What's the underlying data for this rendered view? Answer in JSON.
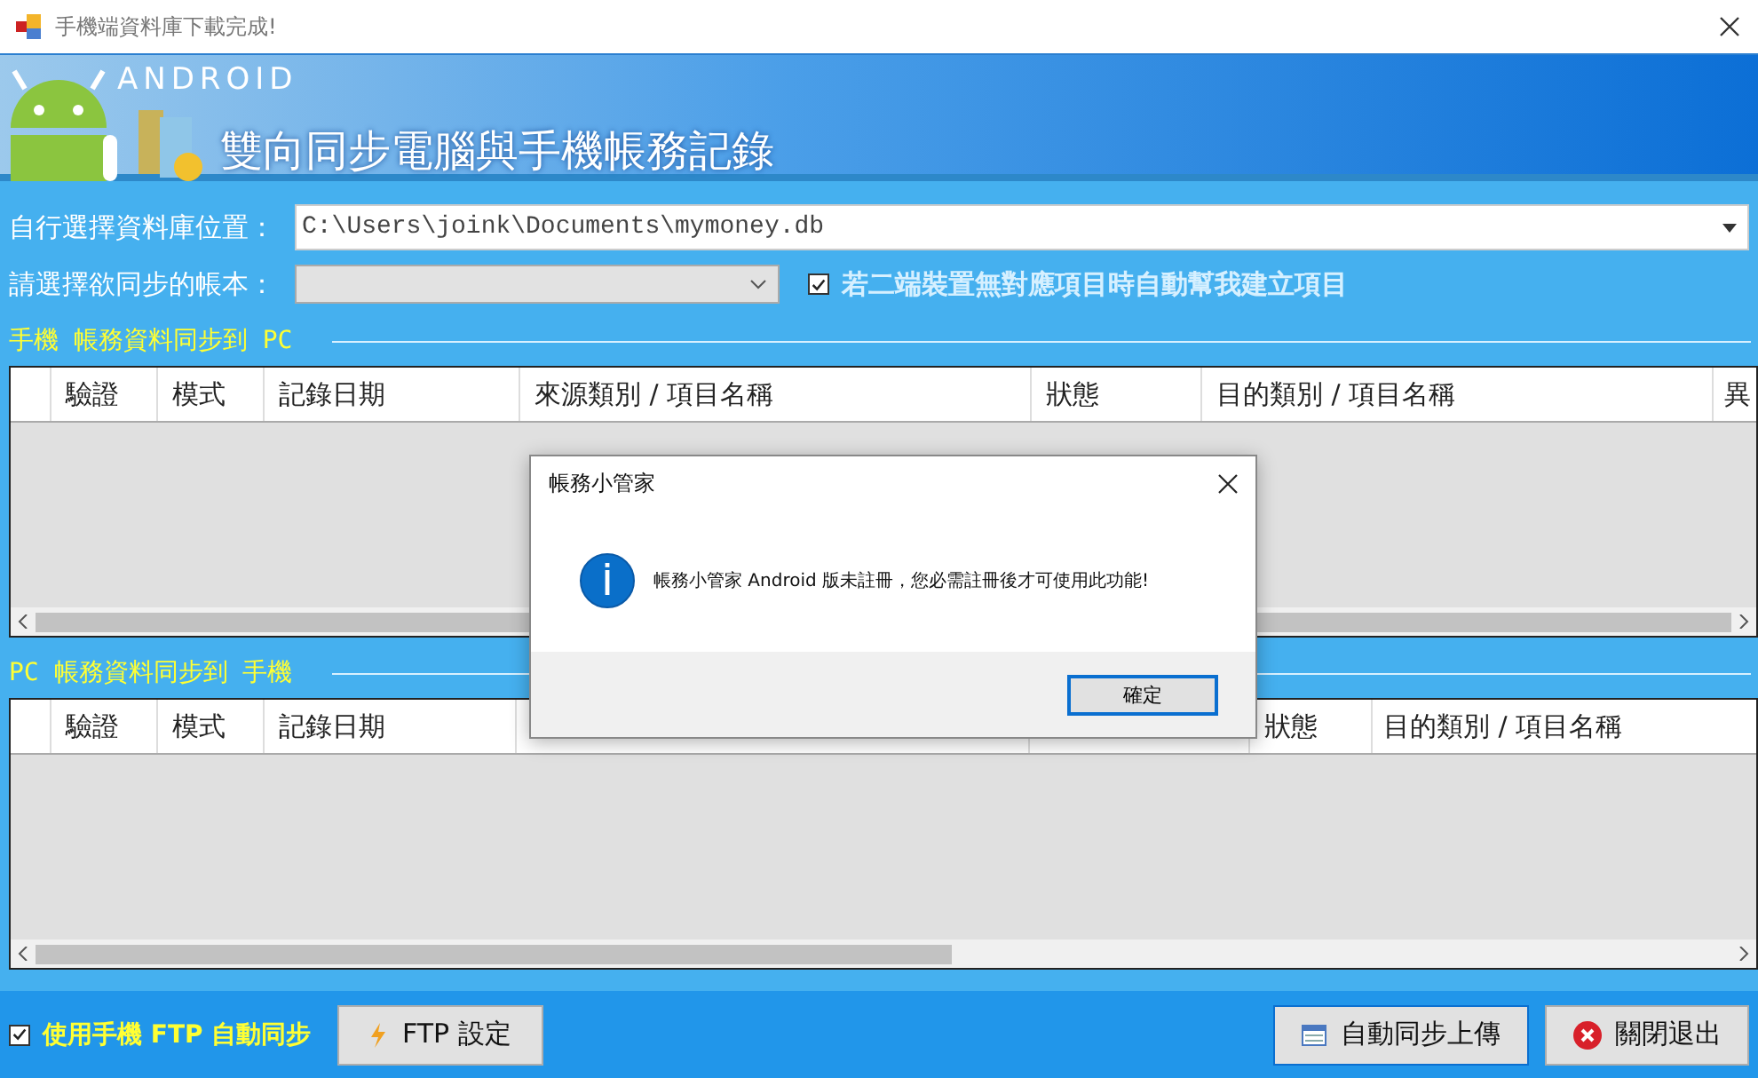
{
  "window": {
    "title": "手機端資料庫下載完成!"
  },
  "banner": {
    "logo": "ANDROID",
    "heading": "雙向同步電腦與手機帳務記錄"
  },
  "db_path": {
    "label": "自行選擇資料庫位置：",
    "value": "C:\\Users\\joink\\Documents\\mymoney.db"
  },
  "account": {
    "label": "請選擇欲同步的帳本：",
    "auto_create": {
      "label": "若二端裝置無對應項目時自動幫我建立項目",
      "checked": true
    }
  },
  "phone_to_pc": {
    "title": "手機 帳務資料同步到 PC",
    "columns": [
      "驗證",
      "模式",
      "記錄日期",
      "來源類別 / 項目名稱",
      "狀態",
      "目的類別 / 項目名稱",
      "異"
    ]
  },
  "pc_to_phone": {
    "title": "PC 帳務資料同步到 手機",
    "columns": [
      "驗證",
      "模式",
      "記錄日期",
      null,
      null,
      "狀態",
      "目的類別 / 項目名稱"
    ]
  },
  "ftp_sync": {
    "label": "使用手機 FTP 自動同步",
    "checked": true
  },
  "buttons": [
    {
      "kind": "ftp",
      "label": "FTP 設定"
    },
    {
      "kind": "upload",
      "label": "自動同步上傳"
    },
    {
      "kind": "exit",
      "label": "關閉退出"
    }
  ],
  "dialog": {
    "title": "帳務小管家",
    "message": "帳務小管家 Android 版未註冊，您必需註冊後才可使用此功能!",
    "button": "確定"
  }
}
